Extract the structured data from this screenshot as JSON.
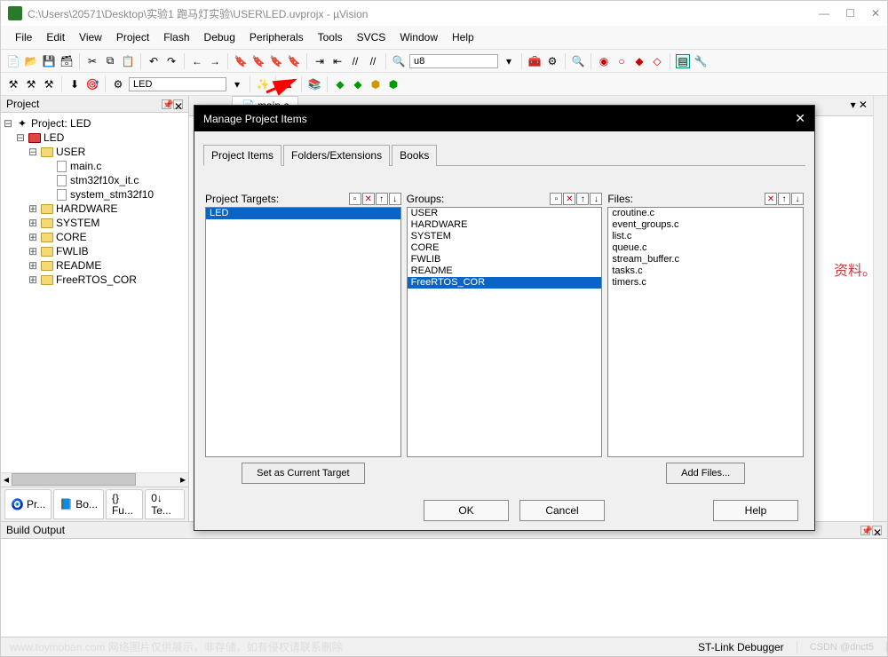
{
  "titlebar": {
    "path": "C:\\Users\\20571\\Desktop\\实验1 跑马灯实验\\USER\\LED.uvprojx - µVision"
  },
  "menu": [
    "File",
    "Edit",
    "View",
    "Project",
    "Flash",
    "Debug",
    "Peripherals",
    "Tools",
    "SVCS",
    "Window",
    "Help"
  ],
  "toolbar2_combo1": "LED",
  "toolbar_combo": "u8",
  "project_panel": {
    "title": "Project",
    "root": "Project: LED",
    "target": "LED",
    "tree": [
      {
        "label": "USER",
        "children": [
          "main.c",
          "stm32f10x_it.c",
          "system_stm32f10"
        ]
      },
      {
        "label": "HARDWARE"
      },
      {
        "label": "SYSTEM"
      },
      {
        "label": "CORE"
      },
      {
        "label": "FWLIB"
      },
      {
        "label": "README"
      },
      {
        "label": "FreeRTOS_COR"
      }
    ],
    "tabs": [
      "Pr...",
      "Bo...",
      "{} Fu...",
      "0↓ Te..."
    ]
  },
  "editor": {
    "tab": "main.c",
    "right_text": "资料。"
  },
  "build_output": {
    "title": "Build Output"
  },
  "statusbar": {
    "status": "ST-Link Debugger",
    "watermark": "www.toymoban.com 网络图片仅供展示，非存储，如有侵权请联系删除",
    "right": "CSDN @dnct5"
  },
  "dialog": {
    "title": "Manage Project Items",
    "tabs": [
      "Project Items",
      "Folders/Extensions",
      "Books"
    ],
    "targets": {
      "label": "Project Targets:",
      "items": [
        "LED"
      ],
      "button": "Set as Current Target"
    },
    "groups": {
      "label": "Groups:",
      "items": [
        "USER",
        "HARDWARE",
        "SYSTEM",
        "CORE",
        "FWLIB",
        "README",
        "FreeRTOS_COR"
      ]
    },
    "files": {
      "label": "Files:",
      "items": [
        "croutine.c",
        "event_groups.c",
        "list.c",
        "queue.c",
        "stream_buffer.c",
        "tasks.c",
        "timers.c"
      ],
      "button": "Add Files..."
    },
    "buttons": {
      "ok": "OK",
      "cancel": "Cancel",
      "help": "Help"
    }
  }
}
